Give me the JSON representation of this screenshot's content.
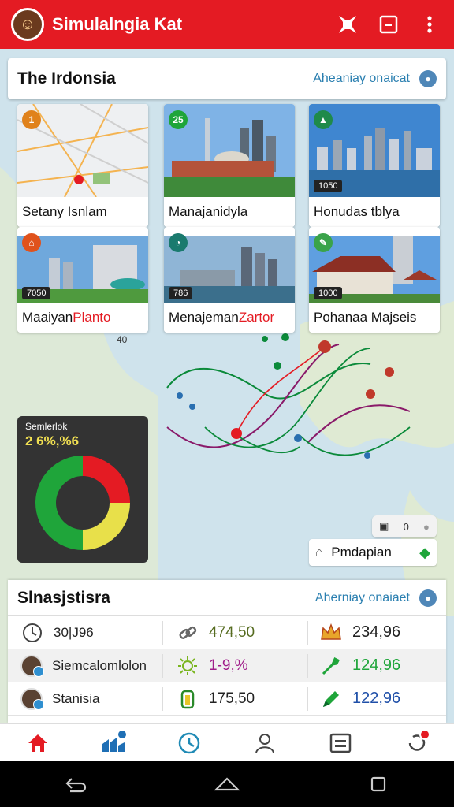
{
  "app": {
    "title": "Simulalngia Kat"
  },
  "region": {
    "title": "The Irdonsia",
    "link": "Aheaniay onaicat"
  },
  "tiles": [
    {
      "caption": "Setany Isnlam",
      "badge": "1"
    },
    {
      "caption": "Manajanidyla",
      "badge": "25"
    },
    {
      "caption": "Honudas tblya",
      "badge": "",
      "chip": "1050"
    },
    {
      "caption": "Maaiyan ",
      "caption_red": "Planto",
      "badge": "",
      "chip": "7050"
    },
    {
      "caption": "Menajeman ",
      "caption_red": "Zartor",
      "badge": "",
      "chip": "786"
    },
    {
      "caption": "Pohanaa Majseis",
      "badge": "",
      "chip": "1000"
    }
  ],
  "map_label": "40",
  "chart": {
    "label": "Semlerlok",
    "value": "2 6%,%6",
    "chart_data": {
      "type": "pie",
      "categories": [
        "Red",
        "Yellow",
        "Green"
      ],
      "values": [
        25,
        25,
        50
      ],
      "colors": [
        "#e41b23",
        "#e8e04a",
        "#1fa53a"
      ]
    }
  },
  "zoom": {
    "value": "0"
  },
  "place_bar": {
    "label": "Pmdapian"
  },
  "stats": {
    "title": "Slnasjstisra",
    "link": "Aherniay onaiaet",
    "rows": [
      {
        "name": "30|J96",
        "mid": "474,50",
        "mid_color": "#556b1f",
        "right": "234,96",
        "right_color": "#222"
      },
      {
        "name": "Siemcalomlolon",
        "mid": "1-9,%",
        "mid_color": "#a01e8a",
        "right": "124,96",
        "right_color": "#1fa53a"
      },
      {
        "name": "Stanisia",
        "mid": "175,50",
        "mid_color": "#222",
        "right": "122,96",
        "right_color": "#1f4fa8"
      }
    ]
  },
  "colors": {
    "brand": "#e41b23",
    "accent": "#2a7fb0"
  }
}
